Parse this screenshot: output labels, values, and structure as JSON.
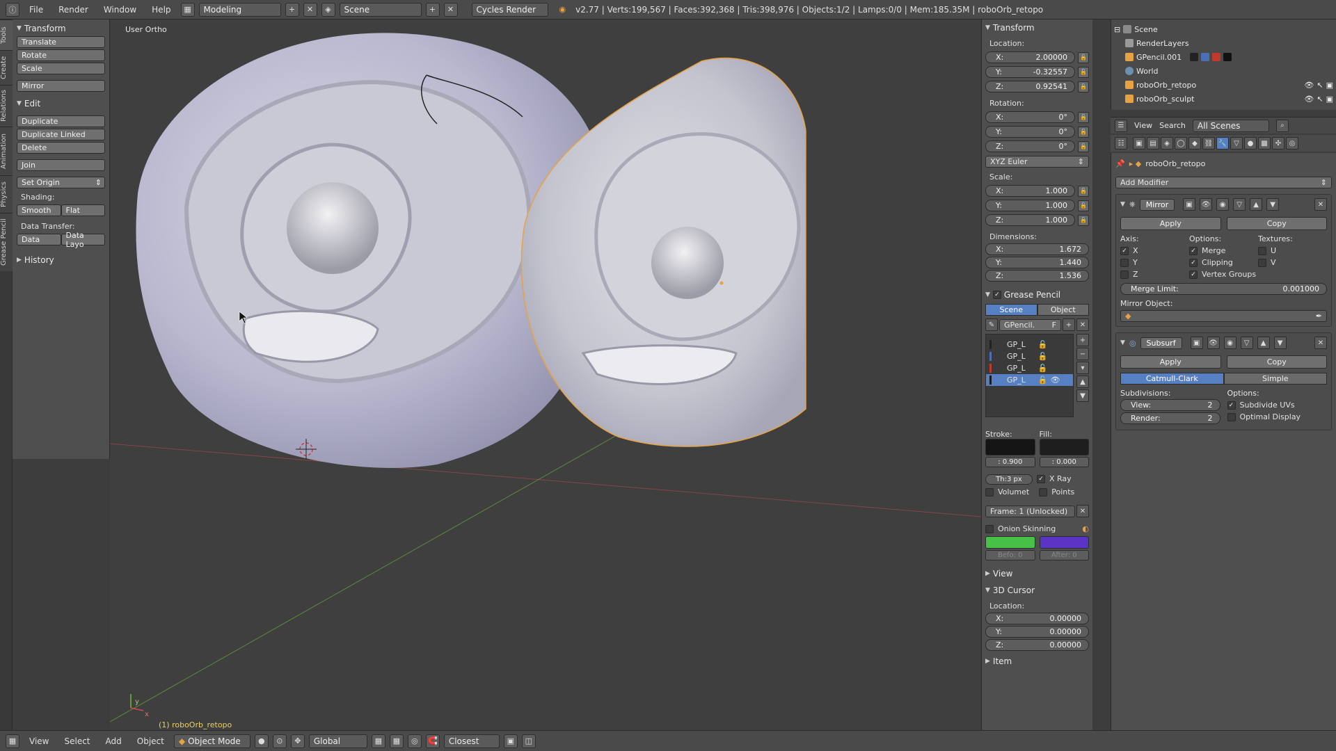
{
  "header": {
    "menus": [
      "File",
      "Render",
      "Window",
      "Help"
    ],
    "layout": "Modeling",
    "scene": "Scene",
    "engine": "Cycles Render",
    "stats": "v2.77 | Verts:199,567 | Faces:392,368 | Tris:398,976 | Objects:1/2 | Lamps:0/0 | Mem:185.35M | roboOrb_retopo"
  },
  "tabs": [
    "Tools",
    "Create",
    "Relations",
    "Animation",
    "Physics",
    "Grease Pencil"
  ],
  "shelf": {
    "transform_title": "Transform",
    "transform_buttons": [
      "Translate",
      "Rotate",
      "Scale",
      "Mirror"
    ],
    "edit_title": "Edit",
    "edit_buttons": [
      "Duplicate",
      "Duplicate Linked",
      "Delete",
      "Join"
    ],
    "set_origin": "Set Origin",
    "shading_label": "Shading:",
    "smooth": "Smooth",
    "flat": "Flat",
    "data_transfer_label": "Data Transfer:",
    "data": "Data",
    "data_layo": "Data Layo",
    "history": "History"
  },
  "viewport": {
    "view_label": "User Ortho",
    "object_label": "(1) roboOrb_retopo",
    "axis_y": "y",
    "axis_x": "x"
  },
  "npanel": {
    "transform_title": "Transform",
    "location_label": "Location:",
    "location": {
      "x": "2.00000",
      "y": "-0.32557",
      "z": "0.92541"
    },
    "rotation_label": "Rotation:",
    "rotation": {
      "x": "0°",
      "y": "0°",
      "z": "0°"
    },
    "euler": "XYZ Euler",
    "scale_label": "Scale:",
    "scale": {
      "x": "1.000",
      "y": "1.000",
      "z": "1.000"
    },
    "dimensions_label": "Dimensions:",
    "dimensions": {
      "x": "1.672",
      "y": "1.440",
      "z": "1.536"
    },
    "grease_title": "Grease Pencil",
    "scene_tab": "Scene",
    "object_tab": "Object",
    "gpencil_name": "GPencil.",
    "gpencil_f": "F",
    "layers": [
      {
        "name": "GP_L",
        "color": "#222222"
      },
      {
        "name": "GP_L",
        "color": "#4a6fb5"
      },
      {
        "name": "GP_L",
        "color": "#c0392b"
      },
      {
        "name": "GP_L",
        "color": "#1a1a1a"
      }
    ],
    "stroke_label": "Stroke:",
    "fill_label": "Fill:",
    "stroke_value": ": 0.900",
    "fill_value": ": 0.000",
    "thickness": "Th:3 px",
    "xray": "X Ray",
    "volumet": "Volumet",
    "points": "Points",
    "frame": "Frame: 1 (Unlocked)",
    "onion": "Onion Skinning",
    "before": "Befo: 0",
    "after": "After: 0",
    "view_title": "View",
    "cursor_title": "3D Cursor",
    "cursor_location_label": "Location:",
    "cursor": {
      "x": "0.00000",
      "y": "0.00000",
      "z": "0.00000"
    },
    "item_title": "Item"
  },
  "outliner": {
    "items": [
      "Scene",
      "RenderLayers",
      "GPencil.001",
      "World",
      "roboOrb_retopo",
      "roboOrb_sculpt"
    ]
  },
  "props": {
    "view": "View",
    "search": "Search",
    "all_scenes": "All Scenes",
    "object_name": "roboOrb_retopo",
    "add_modifier": "Add Modifier",
    "mirror": {
      "name": "Mirror",
      "apply": "Apply",
      "copy": "Copy",
      "axis_label": "Axis:",
      "options_label": "Options:",
      "textures_label": "Textures:",
      "axes": [
        "X",
        "Y",
        "Z"
      ],
      "options": [
        "Merge",
        "Clipping",
        "Vertex Groups"
      ],
      "textures": [
        "U",
        "V"
      ],
      "merge_limit_label": "Merge Limit:",
      "merge_limit": "0.001000",
      "mirror_object_label": "Mirror Object:"
    },
    "subsurf": {
      "name": "Subsurf",
      "apply": "Apply",
      "copy": "Copy",
      "catmull": "Catmull-Clark",
      "simple": "Simple",
      "subdivisions_label": "Subdivisions:",
      "options_label": "Options:",
      "view_label": "View:",
      "view_value": "2",
      "render_label": "Render:",
      "render_value": "2",
      "subdivide_uvs": "Subdivide UVs",
      "optimal_display": "Optimal Display"
    }
  },
  "bottombar": {
    "menus": [
      "View",
      "Select",
      "Add",
      "Object"
    ],
    "mode": "Object Mode",
    "orientation": "Global",
    "snap": "Closest"
  },
  "colors": {
    "accent": "#5680c2",
    "outline": "#e6a243"
  }
}
